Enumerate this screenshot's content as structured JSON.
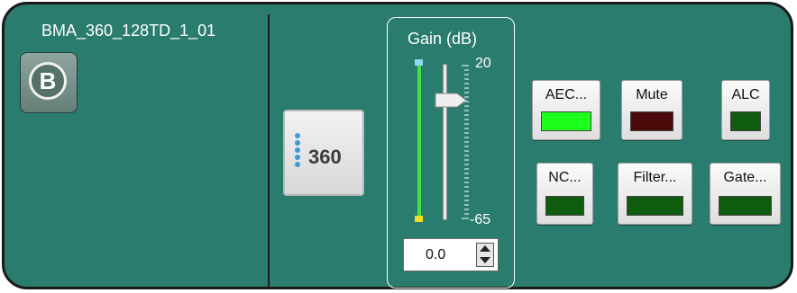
{
  "device": {
    "name": "BMA_360_128TD_1_01",
    "logo_letter": "B",
    "logo_icon": "brand-b-circle-icon"
  },
  "mic_button": {
    "label": "360",
    "icon": "mic-array-dots-icon"
  },
  "gain": {
    "title": "Gain  (dB)",
    "scale_max": "20",
    "scale_min": "-65",
    "value": "0.0",
    "slider_value_db": 0,
    "meter_fill_fraction": 1.0
  },
  "buttons": [
    {
      "label": "AEC...",
      "led_color": "#1dff1d"
    },
    {
      "label": "Mute",
      "led_color": "#4a0a0a"
    },
    {
      "label": "ALC",
      "led_color": "#0f5c0f"
    },
    {
      "label": "NC...",
      "led_color": "#0f5c0f"
    },
    {
      "label": "Filter...",
      "led_color": "#0f5c0f"
    },
    {
      "label": "Gate...",
      "led_color": "#0f5c0f"
    }
  ],
  "colors": {
    "panel": "#2a7d6e",
    "meter": "#44e044",
    "accent_blue": "#3a9bd8"
  }
}
